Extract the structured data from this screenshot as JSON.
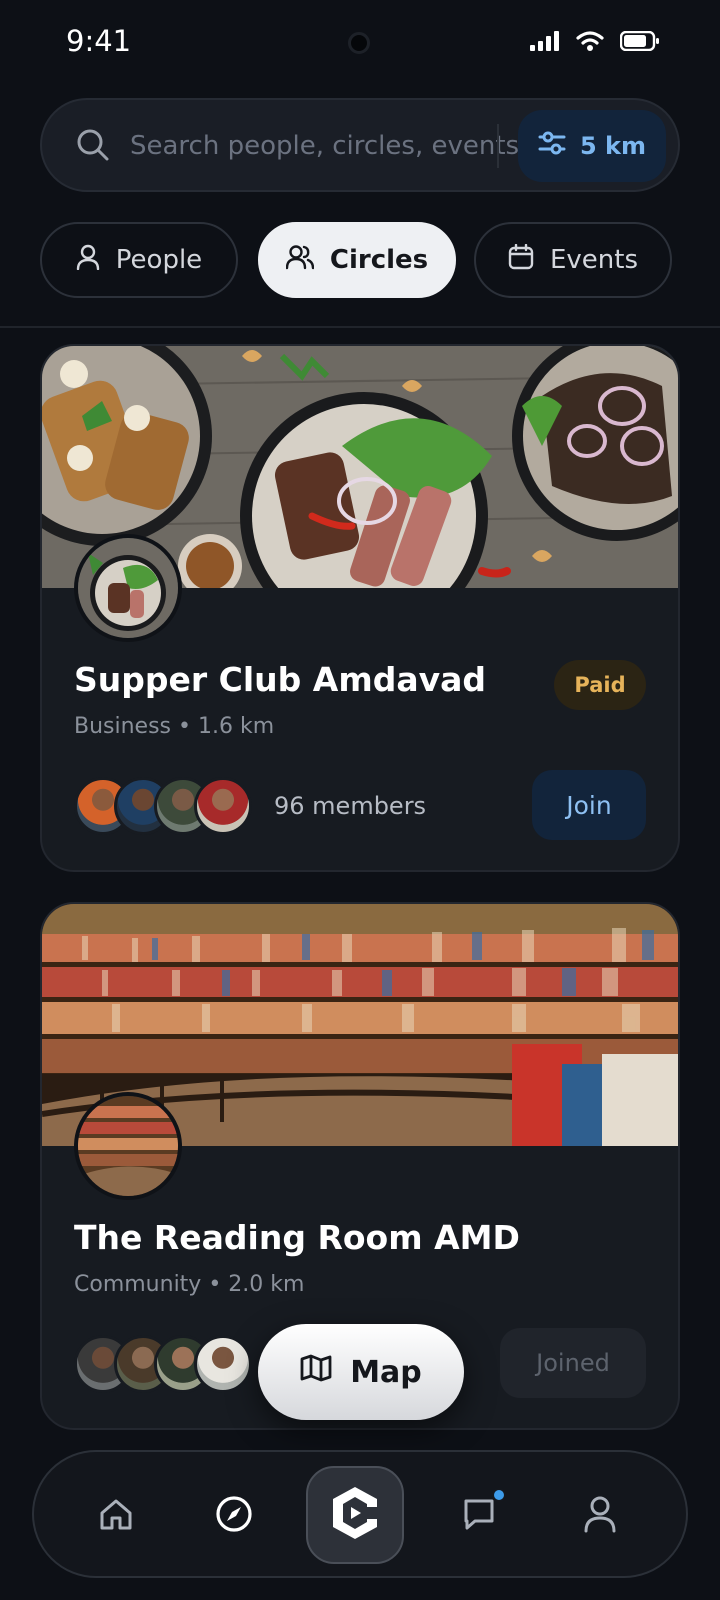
{
  "status_bar": {
    "time": "9:41",
    "icons": [
      "signal-icon",
      "wifi-icon",
      "battery-icon"
    ]
  },
  "search": {
    "placeholder": "Search people, circles, events",
    "value": "",
    "radius_label": "5 km"
  },
  "filter_tabs": [
    {
      "label": "People",
      "icon": "person-icon",
      "active": false
    },
    {
      "label": "Circles",
      "icon": "group-icon",
      "active": true
    },
    {
      "label": "Events",
      "icon": "calendar-icon",
      "active": false
    }
  ],
  "circles": [
    {
      "title": "Supper Club Amdavad",
      "meta": "Business • 1.6 km",
      "badge": "Paid",
      "members_label": "96 members",
      "action_label": "Join"
    },
    {
      "title": "The Reading Room AMD",
      "meta": "Community • 2.0 km",
      "action_label": "Joined"
    }
  ],
  "map_button": {
    "label": "Map"
  },
  "bottom_nav": {
    "items": [
      "home-icon",
      "compass-icon",
      "app-logo-icon",
      "chat-icon",
      "profile-icon"
    ]
  },
  "colors": {
    "background": "#0d1016",
    "card": "#171b21",
    "accent_blue": "#7cb7f0",
    "paid_badge": "#e6b35a"
  }
}
